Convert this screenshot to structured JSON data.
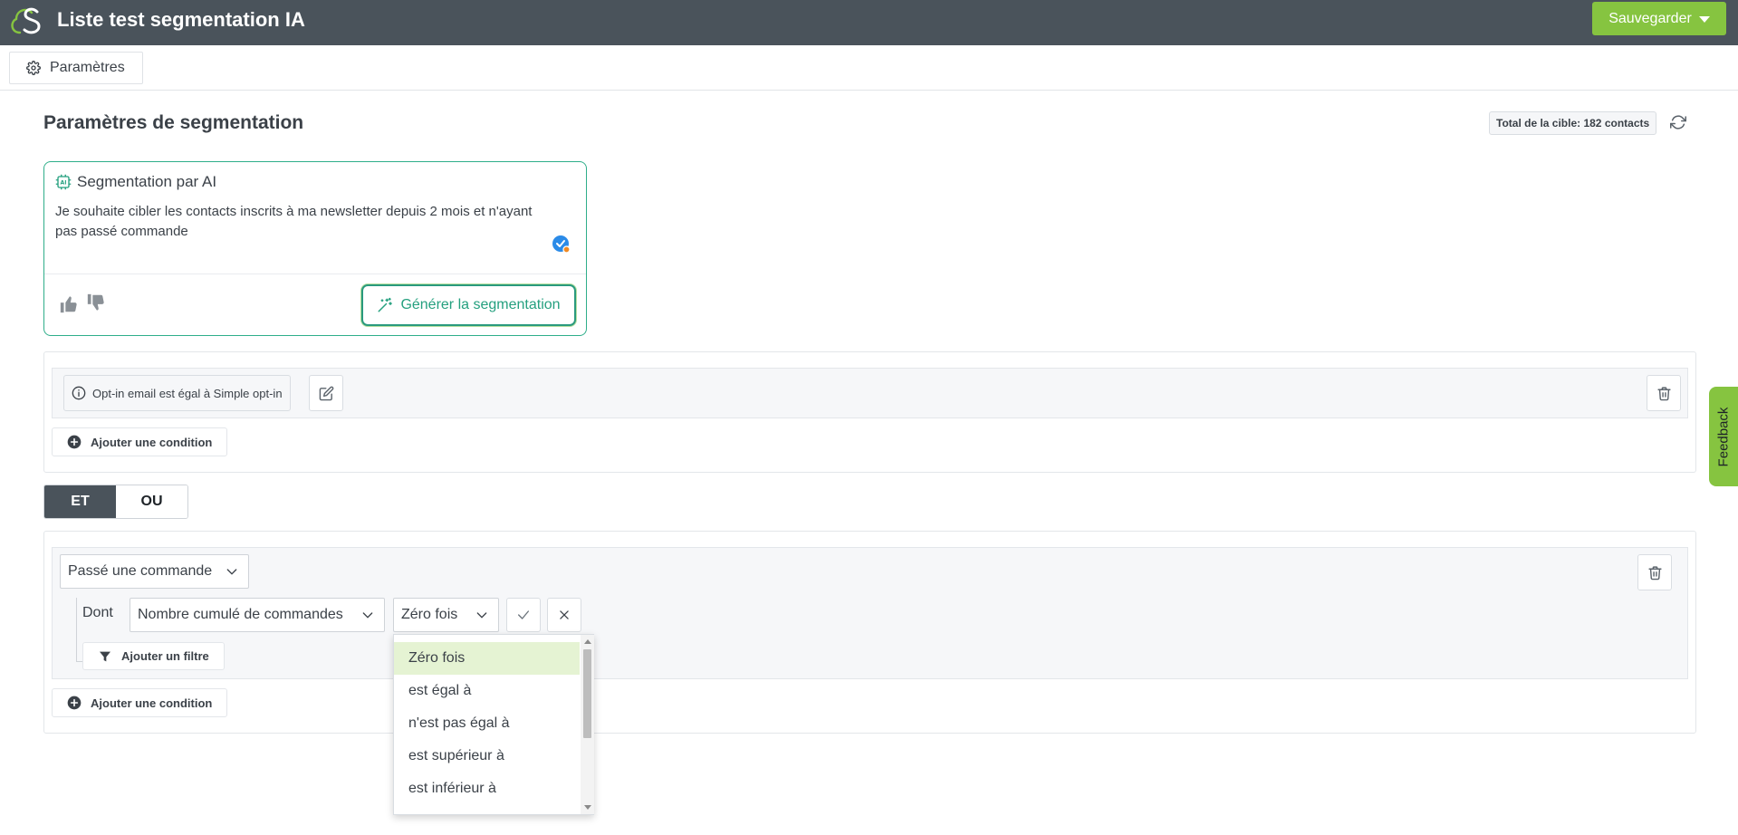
{
  "header": {
    "title": "Liste test segmentation IA",
    "save_label": "Sauvegarder"
  },
  "tabs": [
    {
      "label": "Paramètres",
      "icon": "gear-icon"
    }
  ],
  "section": {
    "title": "Paramètres de segmentation",
    "total_label": "Total de la cible: 182 contacts"
  },
  "ai": {
    "heading": "Segmentation par AI",
    "prompt": "Je souhaite cibler les contacts inscrits à ma newsletter depuis 2 mois et n'ayant pas passé commande",
    "generate_label": "Générer la segmentation"
  },
  "block1": {
    "condition_label": "Opt-in email est égal à Simple opt-in",
    "add_condition_label": "Ajouter une condition"
  },
  "logic": {
    "and_label": "ET",
    "or_label": "OU",
    "selected": "ET"
  },
  "block2": {
    "condition_select": "Passé une commande",
    "dont_label": "Dont",
    "filter_select": "Nombre cumulé de commandes",
    "operator_select": "Zéro fois",
    "add_filter_label": "Ajouter un filtre",
    "add_condition_label": "Ajouter une condition"
  },
  "dropdown": {
    "options": [
      {
        "label": "Zéro fois",
        "selected": true
      },
      {
        "label": "est égal à",
        "selected": false
      },
      {
        "label": "n'est pas égal à",
        "selected": false
      },
      {
        "label": "est supérieur à",
        "selected": false
      },
      {
        "label": "est inférieur à",
        "selected": false
      }
    ]
  },
  "feedback": {
    "label": "Feedback"
  },
  "colors": {
    "topbar": "#4a535b",
    "accent_green": "#86c440",
    "ai_teal": "#25a07f",
    "selected_option": "#e5f3d3"
  }
}
